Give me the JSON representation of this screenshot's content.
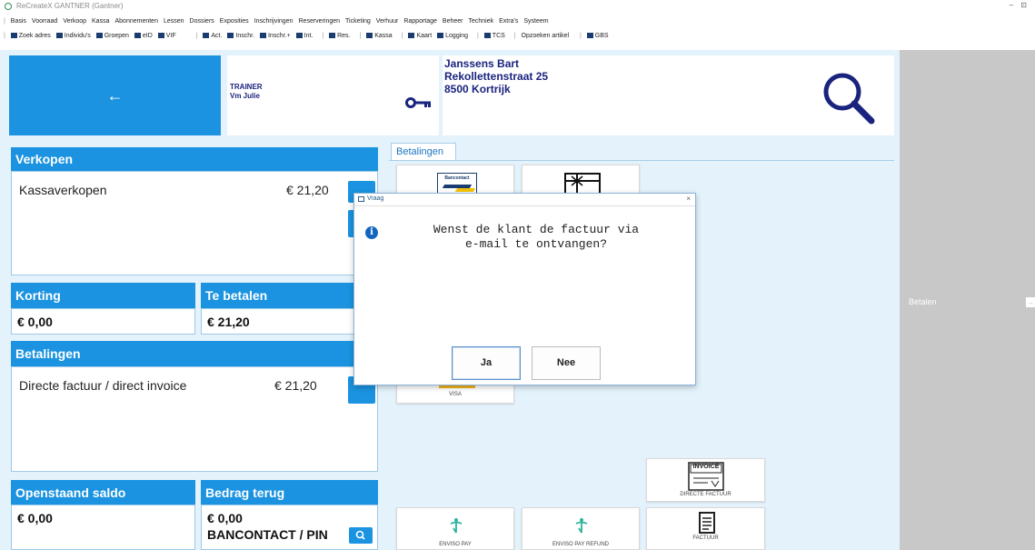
{
  "window": {
    "title": "ReCreateX GANTNER (Gantner)",
    "controls": "– ⊡"
  },
  "menu": [
    "Basis",
    "Voorraad",
    "Verkoop",
    "Kassa",
    "Abonnementen",
    "Lessen",
    "Dossiers",
    "Exposities",
    "Inschrijvingen",
    "Reserveringen",
    "Ticketing",
    "Verhuur",
    "Rapportage",
    "Beheer",
    "Techniek",
    "Extra's",
    "Systeem"
  ],
  "toolbar": {
    "group1": [
      "Zoek adres",
      "Individu's",
      "Groepen",
      "eID",
      "VIF"
    ],
    "group2": [
      "Act.",
      "Inschr.",
      "Inschr.+",
      "Int."
    ],
    "res": "Res.",
    "kassa": "Kassa",
    "kaart": "Kaart",
    "logging": "Logging",
    "tcs": "TCS",
    "opzoeken": "Opzoeken artikel",
    "gbs": "GBS"
  },
  "header": {
    "back_arrow": "←",
    "trainer_label": "TRAINER",
    "trainer_name": "Vm Julie",
    "customer": {
      "name": "Janssens Bart",
      "street": "Rekollettenstraat 25",
      "city": "8500 Kortrijk"
    }
  },
  "verkopen": {
    "title": "Verkopen",
    "item_label": "Kassaverkopen",
    "item_amount": "€ 21,20"
  },
  "korting": {
    "title": "Korting",
    "value": "€ 0,00"
  },
  "te_betalen": {
    "title": "Te betalen",
    "value": "€ 21,20"
  },
  "betalingen_left": {
    "title": "Betalingen",
    "item_label": "Directe factuur / direct invoice",
    "item_amount": "€ 21,20"
  },
  "openstaand": {
    "title": "Openstaand saldo",
    "value": "€ 0,00"
  },
  "bedrag_terug": {
    "title": "Bedrag terug",
    "value": "€ 0,00",
    "method": "BANCONTACT / PIN"
  },
  "payments_tab": {
    "label": "Betalingen",
    "tiles": {
      "bancontact_logo": "Bancontact",
      "visa": "VISA",
      "invoice_logo": "INVOICE",
      "directe_factuur": "DIRECTE FACTUUR",
      "enviso_pay": "ENVISO PAY",
      "enviso_refund": "ENVISO PAY REFUND",
      "factuur": "FACTUUR"
    }
  },
  "right_panel": {
    "label": "Betalen",
    "arrow": "→"
  },
  "dialog": {
    "title": "Vraag",
    "close": "×",
    "info_glyph": "i",
    "message_line1": "Wenst de klant de factuur via",
    "message_line2": "e-mail te ontvangen?",
    "yes": "Ja",
    "no": "Nee"
  }
}
